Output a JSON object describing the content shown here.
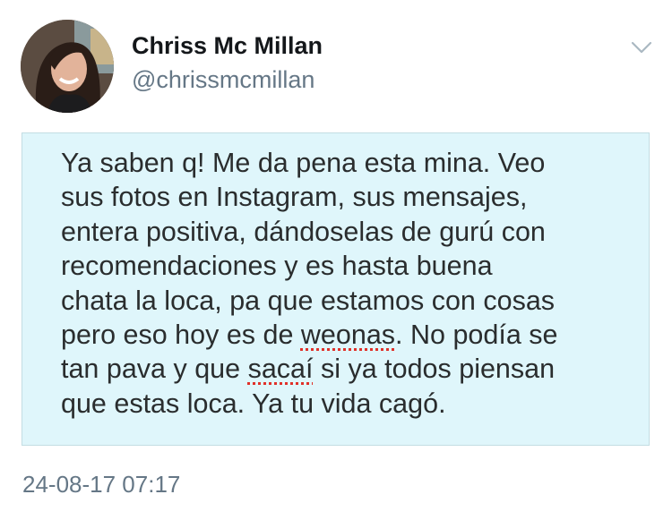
{
  "tweet": {
    "author": {
      "display_name": "Chriss Mc Millan",
      "handle": "@chrissmcmillan",
      "avatar_icon": "profile-photo"
    },
    "menu_icon": "chevron-down-icon",
    "note_screenshot": {
      "background_color": "#dff6fb",
      "lines": [
        {
          "parts": [
            {
              "text": "Ya saben q! Me da pena esta mina. Veo"
            }
          ]
        },
        {
          "parts": [
            {
              "text": "sus fotos en Instagram, sus mensajes,"
            }
          ]
        },
        {
          "parts": [
            {
              "text": "entera positiva, dándoselas de gurú con"
            }
          ]
        },
        {
          "parts": [
            {
              "text": "recomendaciones y es hasta buena"
            }
          ]
        },
        {
          "parts": [
            {
              "text": "chata la loca, pa que estamos con cosas"
            }
          ]
        },
        {
          "parts": [
            {
              "text": "pero eso hoy es de "
            },
            {
              "text": "weonas",
              "spell_error": true
            },
            {
              "text": ". No podía se"
            }
          ]
        },
        {
          "parts": [
            {
              "text": "tan pava y que "
            },
            {
              "text": "sacaí",
              "spell_error": true
            },
            {
              "text": " si ya todos piensan"
            }
          ]
        },
        {
          "parts": [
            {
              "text": "que estas loca. Ya tu vida cagó."
            }
          ]
        }
      ]
    },
    "timestamp": "24-08-17 07:17"
  }
}
